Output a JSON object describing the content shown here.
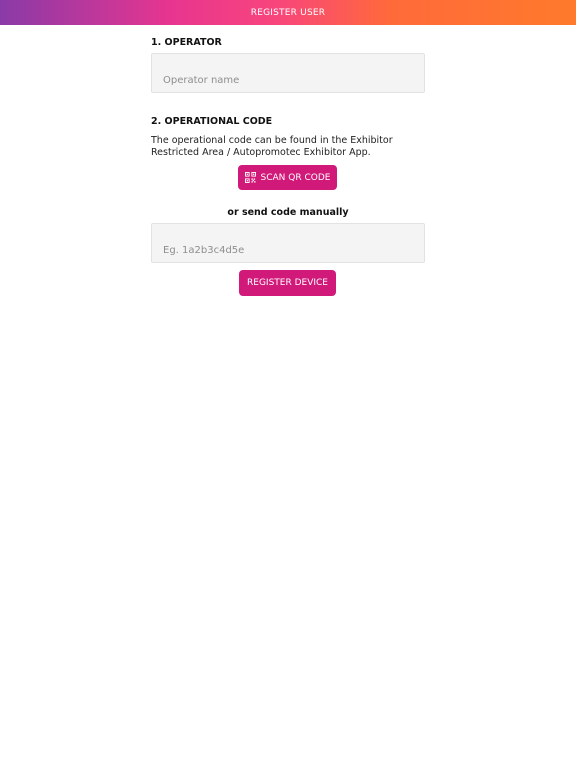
{
  "header": {
    "title": "REGISTER USER"
  },
  "operator": {
    "section_title": "1. OPERATOR",
    "input_placeholder": "Operator name",
    "input_value": ""
  },
  "operational_code": {
    "section_title": "2. OPERATIONAL CODE",
    "description": "The operational code can be found in the Exhibitor Restricted Area / Autopromotec Exhibitor App.",
    "scan_button_label": "SCAN QR CODE",
    "scan_button_icon": "qr-code-icon",
    "manual_label": "or send code manually",
    "code_input_placeholder": "Eg. 1a2b3c4d5e",
    "code_input_value": "",
    "register_button_label": "REGISTER DEVICE"
  },
  "colors": {
    "header_gradient_start": "#8a3aa8",
    "header_gradient_end": "#ff7a2c",
    "button": "#d1197a",
    "input_background": "#f4f4f4"
  }
}
